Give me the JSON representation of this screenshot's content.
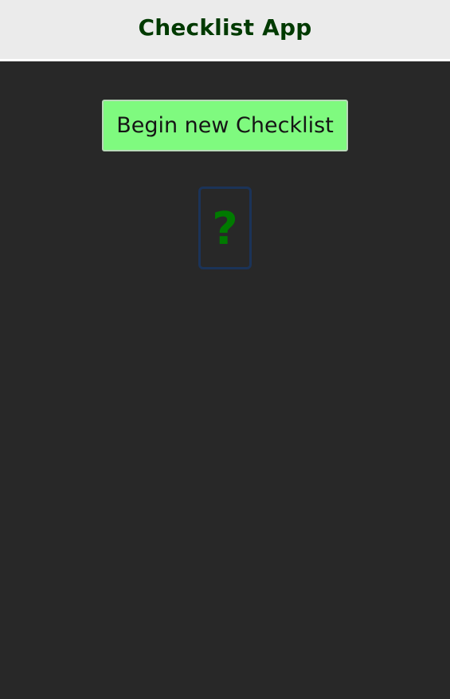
{
  "header": {
    "title": "Checklist App"
  },
  "main": {
    "begin_button_label": "Begin new Checklist",
    "help_button": {
      "icon": "question-mark-icon",
      "glyph": "?"
    }
  },
  "colors": {
    "header_bg": "#ebebeb",
    "title_text": "#003a00",
    "page_bg": "#282828",
    "begin_button_bg": "#7ffa7f",
    "help_border": "#1b3358",
    "help_glyph": "#007a00"
  }
}
